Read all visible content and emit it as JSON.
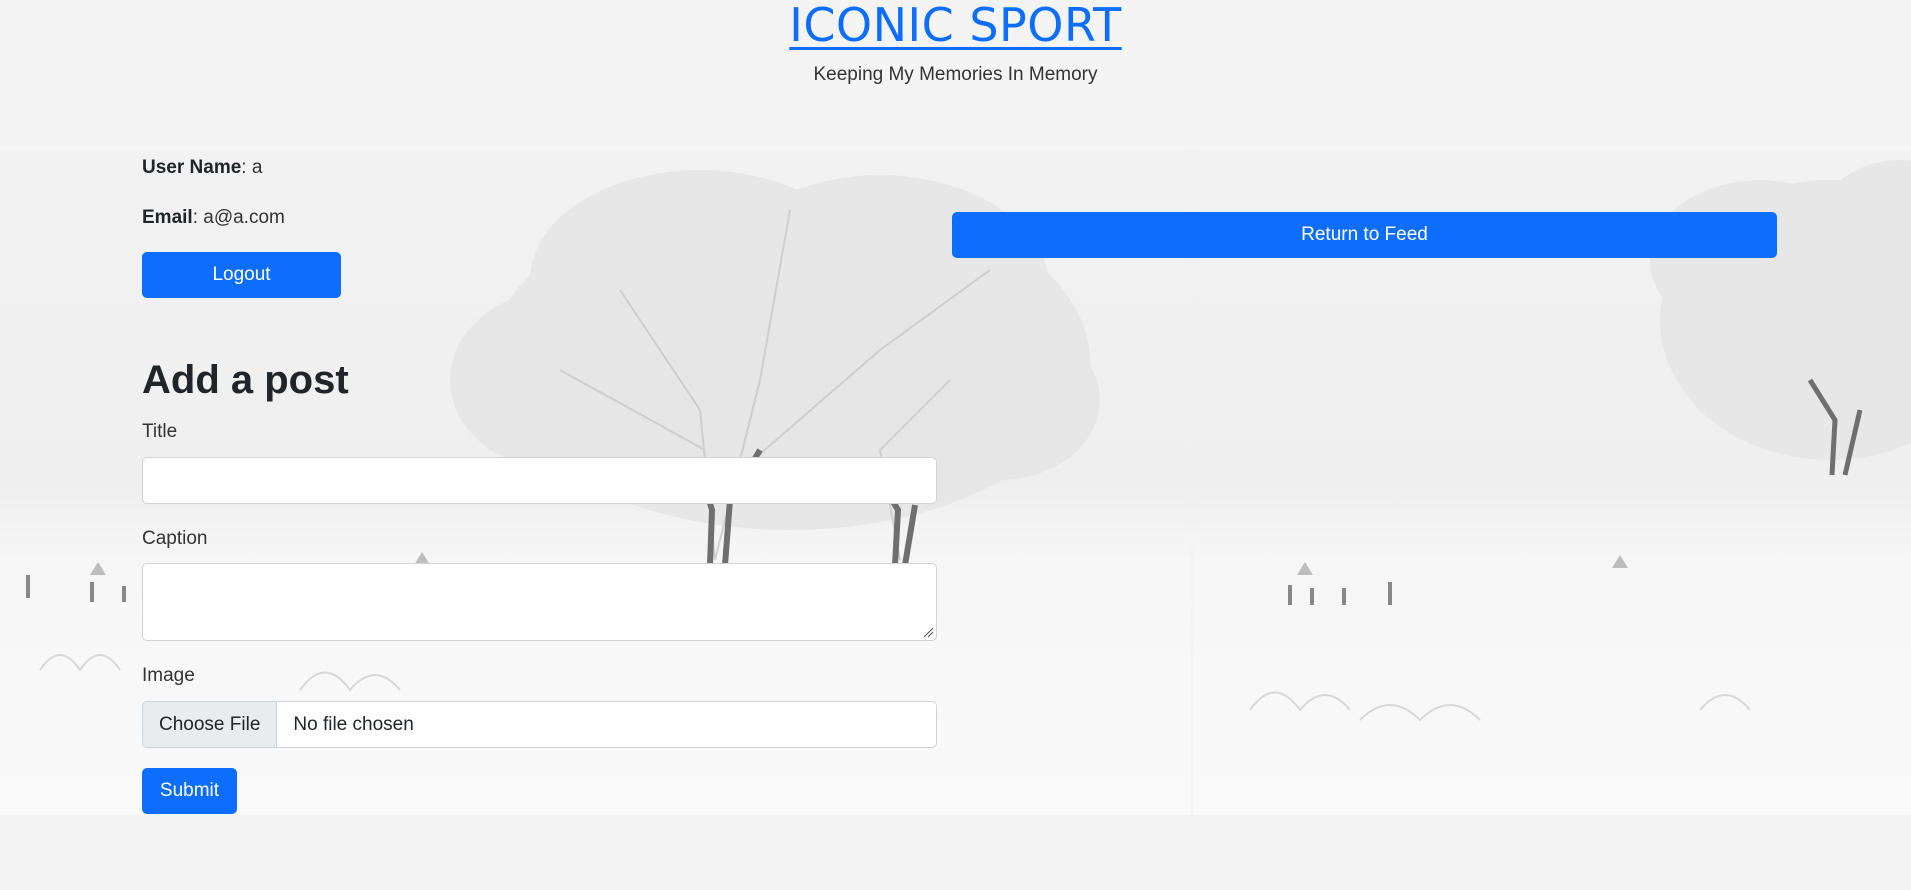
{
  "header": {
    "site_title": "ICONIC SPORT",
    "tagline": "Keeping My Memories In Memory"
  },
  "profile": {
    "username_label": "User Name",
    "username_value": ": a",
    "email_label": "Email",
    "email_value": ": a@a.com",
    "logout_label": "Logout"
  },
  "nav": {
    "return_label": "Return to Feed"
  },
  "form": {
    "heading": "Add a post",
    "title_label": "Title",
    "title_value": "",
    "caption_label": "Caption",
    "caption_value": "",
    "image_label": "Image",
    "choose_file_label": "Choose File",
    "file_status": "No file chosen",
    "submit_label": "Submit"
  },
  "colors": {
    "primary": "#0d6efd",
    "background": "#f4f4f4"
  }
}
